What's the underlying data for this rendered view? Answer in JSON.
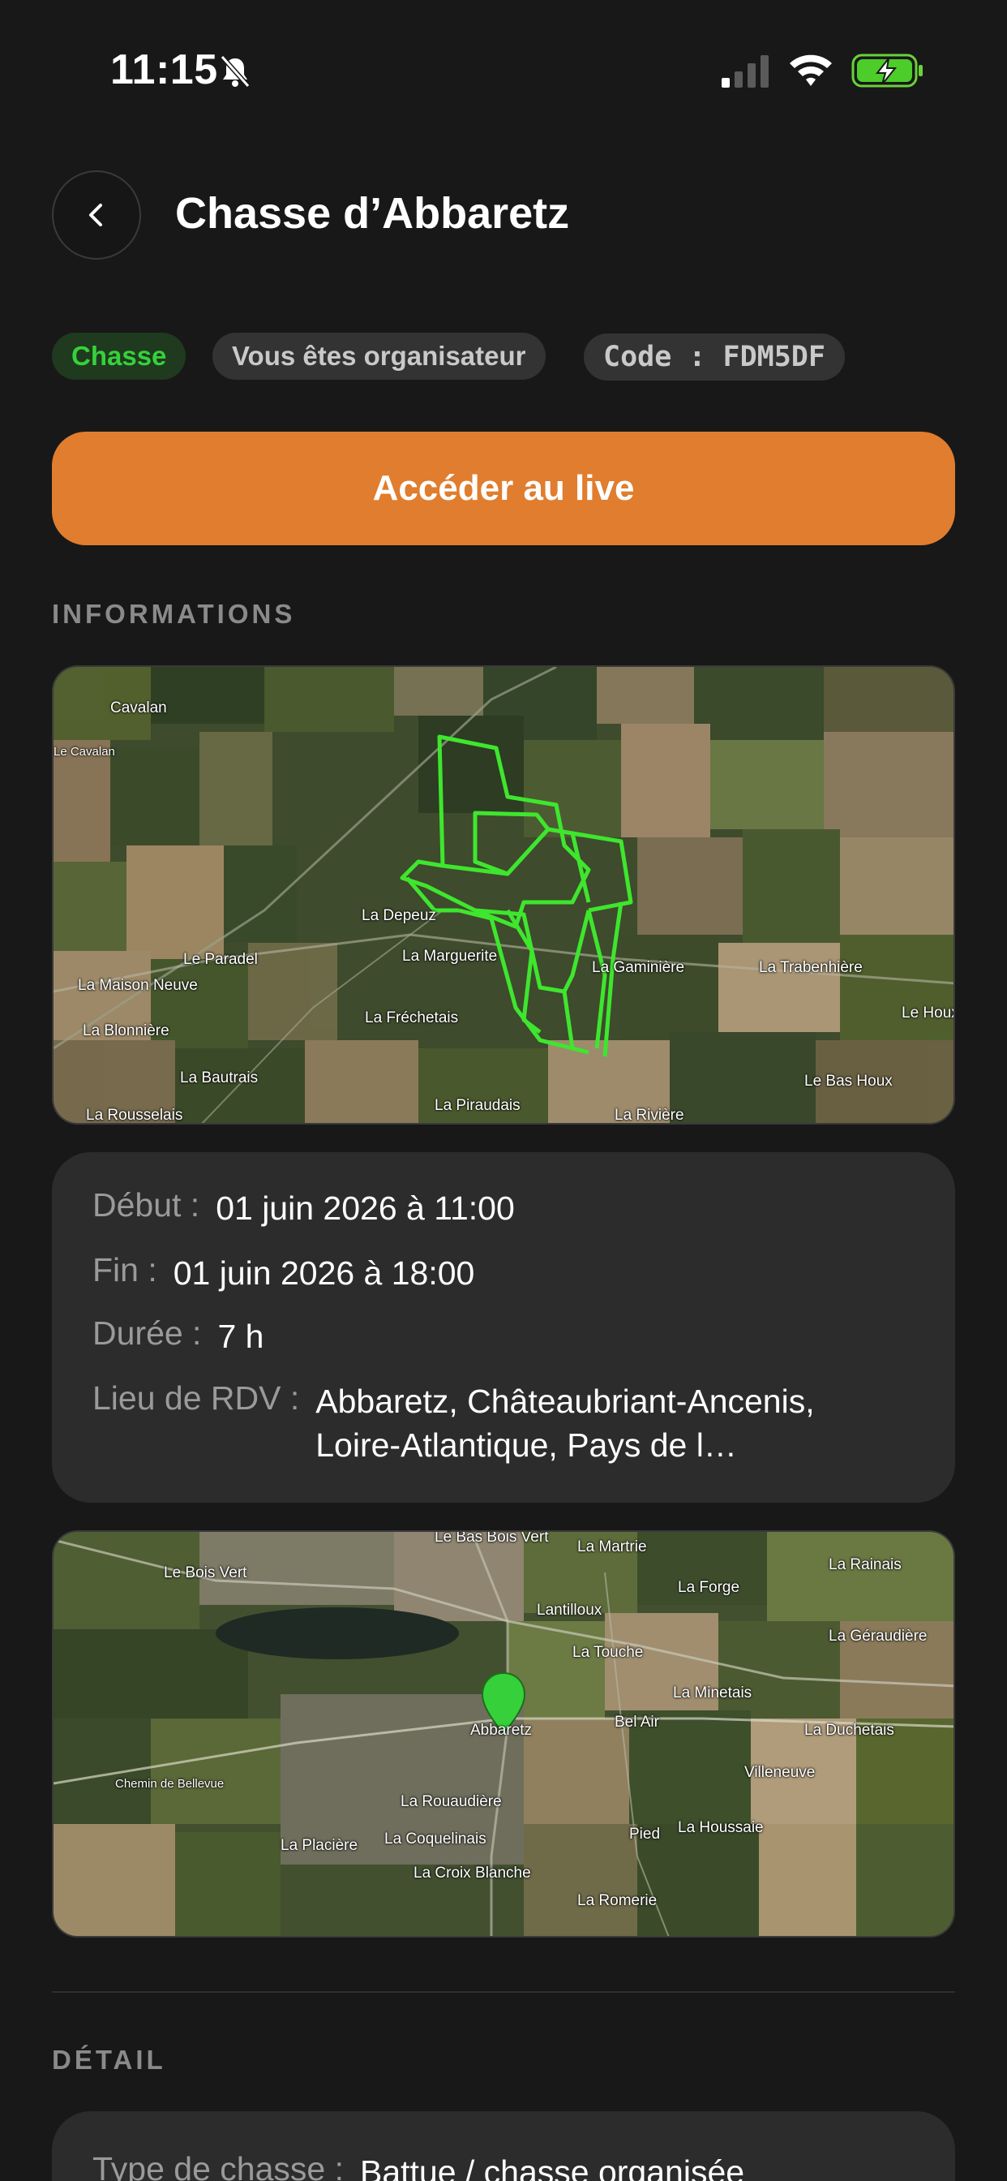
{
  "status_bar": {
    "time": "11:15"
  },
  "header": {
    "title": "Chasse d’Abbaretz",
    "back_icon": "chevron-left-icon"
  },
  "tags": {
    "type": "Chasse",
    "role": "Vous êtes organisateur",
    "code": "Code : FDM5DF"
  },
  "live_button": {
    "label": "Accéder au live"
  },
  "sections": {
    "informations": "INFORMATIONS",
    "detail": "DÉTAIL"
  },
  "territory_map": {
    "labels": [
      "Cavalan",
      "Le Cavalan",
      "La Depeuz",
      "La Marguerite",
      "Le Paradel",
      "La Maison Neuve",
      "La Blonnière",
      "La Fréchetais",
      "La Bautrais",
      "La Rousselais",
      "La Piraudais",
      "La Rivière",
      "Le Bas Houx",
      "Le Houx",
      "La Trabenhière",
      "La Gaminière"
    ]
  },
  "info": {
    "start_key": "Début :",
    "start_val": "01 juin 2026 à 11:00",
    "end_key": "Fin :",
    "end_val": "01 juin 2026 à 18:00",
    "duration_key": "Durée :",
    "duration_val": "7 h",
    "place_key": "Lieu de RDV :",
    "place_val": "Abbaretz, Châteaubriant-Ancenis, Loire-Atlantique, Pays de l…"
  },
  "meeting_map": {
    "labels": [
      "Le Bas Bois Vert",
      "Le Bois Vert",
      "La Martrie",
      "La Rainais",
      "La Forge",
      "Lantilloux",
      "La Géraudière",
      "La Touche",
      "La Minetais",
      "Abbaretz",
      "Bel Air",
      "La Duchetais",
      "Chemin de Bellevue",
      "La Rouaudière",
      "Villeneuve",
      "Pied",
      "La Houssaie",
      "La Placière",
      "La Coquelinais",
      "La Croix Blanche",
      "La Romerie"
    ],
    "pin_icon": "map-pin-icon"
  },
  "detail": {
    "type_key": "Type de chasse :",
    "type_val": "Battue / chasse organisée"
  },
  "colors": {
    "accent_orange": "#e07d2e",
    "tag_green": "#36d13a",
    "background": "#181818",
    "card": "#2c2c2c"
  }
}
